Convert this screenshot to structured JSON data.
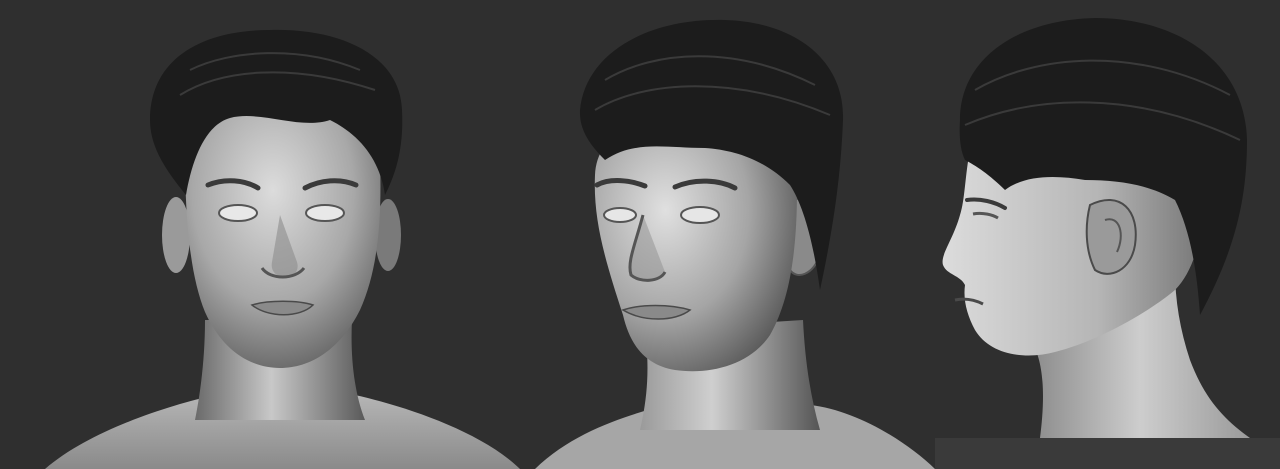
{
  "scene": {
    "background_color": "#2f2f2f",
    "panel_bottom_color": "#3a3a3a",
    "skin_light": "#d2d2d2",
    "skin_mid": "#9a9a9a",
    "skin_shadow": "#4a4a4a",
    "hair_color": "#1c1c1c",
    "views": [
      {
        "id": "front",
        "icon": "front-head-view"
      },
      {
        "id": "three-quarter",
        "icon": "three-quarter-head-view"
      },
      {
        "id": "profile",
        "icon": "profile-head-view"
      }
    ]
  }
}
